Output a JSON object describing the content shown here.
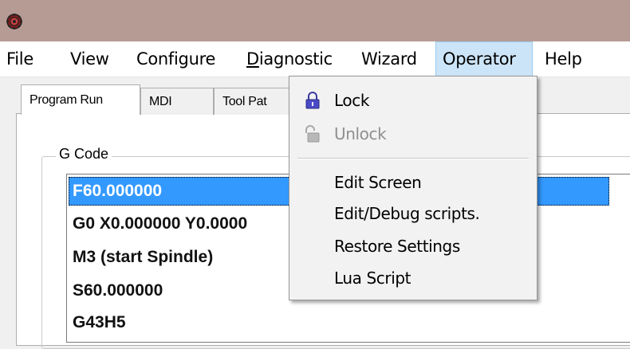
{
  "titlebar": {
    "icon": "app-gear-icon"
  },
  "menubar": {
    "items": [
      "File",
      "View",
      "Configure",
      "Diagnostic",
      "Wizard",
      "Operator",
      "Help"
    ],
    "active": "Operator"
  },
  "tabs": {
    "items": [
      "Program Run",
      "MDI",
      "Tool Pat"
    ],
    "selected": "Program Run"
  },
  "gcode": {
    "group_label": "G Code",
    "lines": [
      "F60.000000",
      "G0 X0.000000 Y0.0000",
      "M3 (start Spindle)",
      "S60.000000",
      "G43H5"
    ],
    "selected_index": 0
  },
  "operator_menu": {
    "items": [
      {
        "label": "Lock",
        "icon": "lock-icon",
        "enabled": true
      },
      {
        "label": "Unlock",
        "icon": "unlock-icon",
        "enabled": false
      },
      {
        "label": "Edit Screen",
        "enabled": true
      },
      {
        "label": "Edit/Debug scripts.",
        "enabled": true
      },
      {
        "label": "Restore Settings",
        "enabled": true
      },
      {
        "label": "Lua Script",
        "enabled": true
      }
    ]
  },
  "colors": {
    "titlebar": "#b69b94",
    "menu_highlight": "#cce4f7",
    "selection": "#3399ff"
  }
}
